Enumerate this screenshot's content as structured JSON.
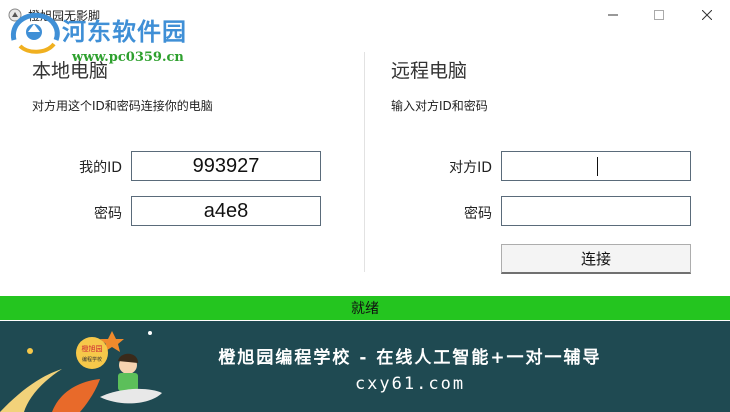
{
  "window": {
    "title": "橙旭园无影脚",
    "controls": {
      "minimize": "—",
      "maximize": "☐",
      "close": "✕"
    }
  },
  "watermark": {
    "name": "河东软件园",
    "url": "www.pc0359.cn"
  },
  "local": {
    "title": "本地电脑",
    "subtitle": "对方用这个ID和密码连接你的电脑",
    "id_label": "我的ID",
    "id_value": "993927",
    "password_label": "密码",
    "password_value": "a4e8"
  },
  "remote": {
    "title": "远程电脑",
    "subtitle": "输入对方ID和密码",
    "id_label": "对方ID",
    "id_value": "",
    "password_label": "密码",
    "password_value": "",
    "connect_label": "连接"
  },
  "status": {
    "text": "就绪"
  },
  "banner": {
    "line1": "橙旭园编程学校 - 在线人工智能+一对一辅导",
    "line2": "cxy61.com",
    "logo_text": "橙旭园",
    "logo_subtext": "编程学校"
  },
  "colors": {
    "status_bar": "#24c51f",
    "banner_bg": "#1f4a52",
    "watermark_blue": "#3f8fd6",
    "watermark_green": "#2ea02e"
  }
}
